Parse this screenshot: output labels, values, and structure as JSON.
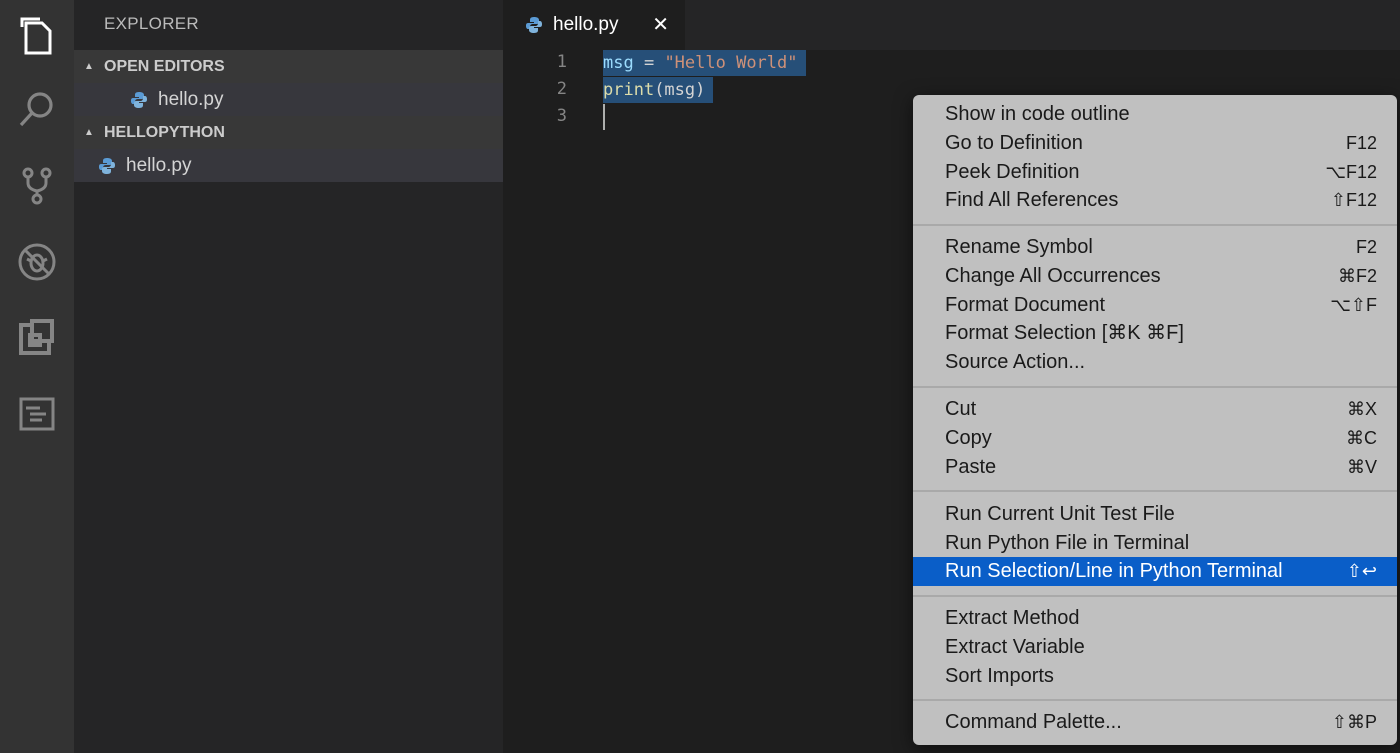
{
  "sidebar": {
    "title": "EXPLORER",
    "open_editors": {
      "label": "OPEN EDITORS",
      "files": [
        "hello.py"
      ]
    },
    "folder": {
      "label": "HELLOPYTHON",
      "files": [
        "hello.py"
      ]
    }
  },
  "editor": {
    "tab": {
      "label": "hello.py",
      "close": "✕"
    },
    "line_numbers": [
      "1",
      "2",
      "3"
    ],
    "code": {
      "line1": {
        "var": "msg",
        "op": " = ",
        "str": "\"Hello World\""
      },
      "line2": {
        "fn": "print",
        "rest": "(msg)"
      }
    }
  },
  "context_menu": {
    "groups": [
      [
        {
          "label": "Show in code outline",
          "key": ""
        },
        {
          "label": "Go to Definition",
          "key": "F12"
        },
        {
          "label": "Peek Definition",
          "key": "⌥F12"
        },
        {
          "label": "Find All References",
          "key": "⇧F12"
        }
      ],
      [
        {
          "label": "Rename Symbol",
          "key": "F2"
        },
        {
          "label": "Change All Occurrences",
          "key": "⌘F2"
        },
        {
          "label": "Format Document",
          "key": "⌥⇧F"
        },
        {
          "label": "Format Selection [⌘K ⌘F]",
          "key": ""
        },
        {
          "label": "Source Action...",
          "key": ""
        }
      ],
      [
        {
          "label": "Cut",
          "key": "⌘X"
        },
        {
          "label": "Copy",
          "key": "⌘C"
        },
        {
          "label": "Paste",
          "key": "⌘V"
        }
      ],
      [
        {
          "label": "Run Current Unit Test File",
          "key": ""
        },
        {
          "label": "Run Python File in Terminal",
          "key": ""
        },
        {
          "label": "Run Selection/Line in Python Terminal",
          "key": "⇧↩"
        }
      ],
      [
        {
          "label": "Extract Method",
          "key": ""
        },
        {
          "label": "Extract Variable",
          "key": ""
        },
        {
          "label": "Sort Imports",
          "key": ""
        }
      ],
      [
        {
          "label": "Command Palette...",
          "key": "⇧⌘P"
        }
      ]
    ]
  },
  "colors": {
    "accent": "#0a5ec8",
    "selection": "#264f78",
    "string": "#ce9178",
    "function": "#dcdcaa",
    "variable": "#9cdcfe"
  }
}
